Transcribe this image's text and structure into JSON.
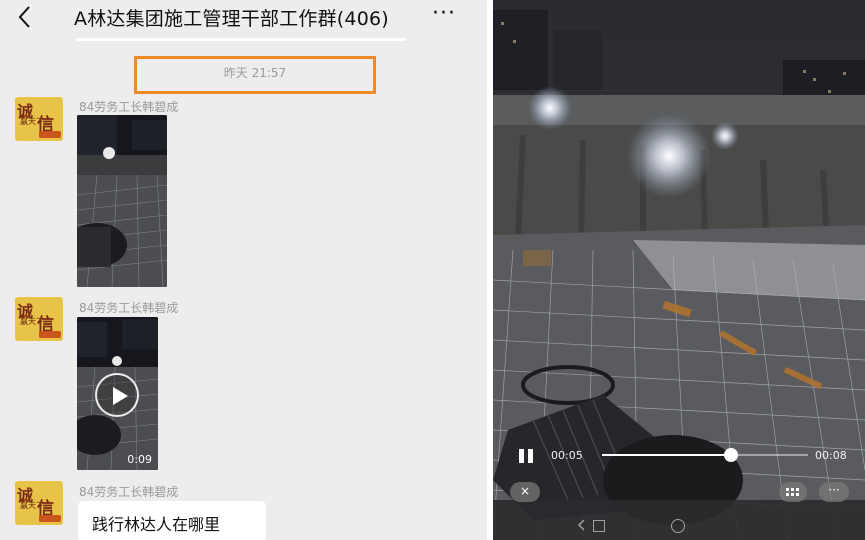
{
  "chat": {
    "title": "A林达集团施工管理干部工作群(406)",
    "more_label": "···",
    "timestamp": "昨天 21:57",
    "messages": [
      {
        "sender": "84劳务工长韩碧成",
        "type": "video",
        "duration": ""
      },
      {
        "sender": "84劳务工长韩碧成",
        "type": "video",
        "duration": "0:09"
      },
      {
        "sender": "84劳务工长韩碧成",
        "type": "text",
        "text": "践行林达人在哪里"
      }
    ],
    "avatar": {
      "char_top": "诚",
      "char_right": "信",
      "char_small": "赢天下",
      "colors": {
        "bg": "#e8c34a",
        "text": "#7a2a14"
      }
    }
  },
  "player": {
    "elapsed": "00:05",
    "total": "00:08",
    "progress": 0.625,
    "close_label": "×",
    "more_label": "···",
    "icons": [
      "pause-icon",
      "close-icon",
      "grid-icon",
      "more-icon",
      "nav-back-icon",
      "nav-square-icon",
      "nav-home-icon"
    ]
  },
  "colors": {
    "highlight_border": "#f08a24",
    "chat_bg": "#ededed"
  }
}
